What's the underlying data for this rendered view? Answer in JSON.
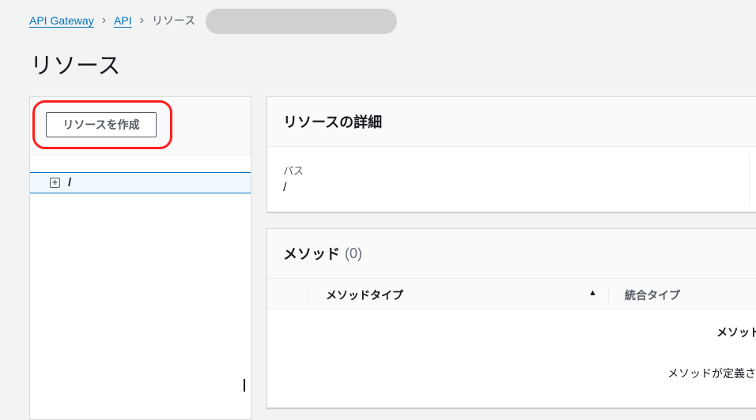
{
  "breadcrumb": {
    "items": [
      "API Gateway",
      "API"
    ],
    "current": "リソース"
  },
  "page_title": "リソース",
  "left_panel": {
    "create_button": "リソースを作成",
    "tree": [
      {
        "path": "/"
      }
    ]
  },
  "details": {
    "title": "リソースの詳細",
    "path_label": "パス",
    "path_value": "/"
  },
  "methods": {
    "title": "メソッド",
    "count": "(0)",
    "columns": [
      "メソッドタイプ",
      "統合タイプ"
    ],
    "empty_title": "メソッド",
    "empty_text": "メソッドが定義さ"
  }
}
